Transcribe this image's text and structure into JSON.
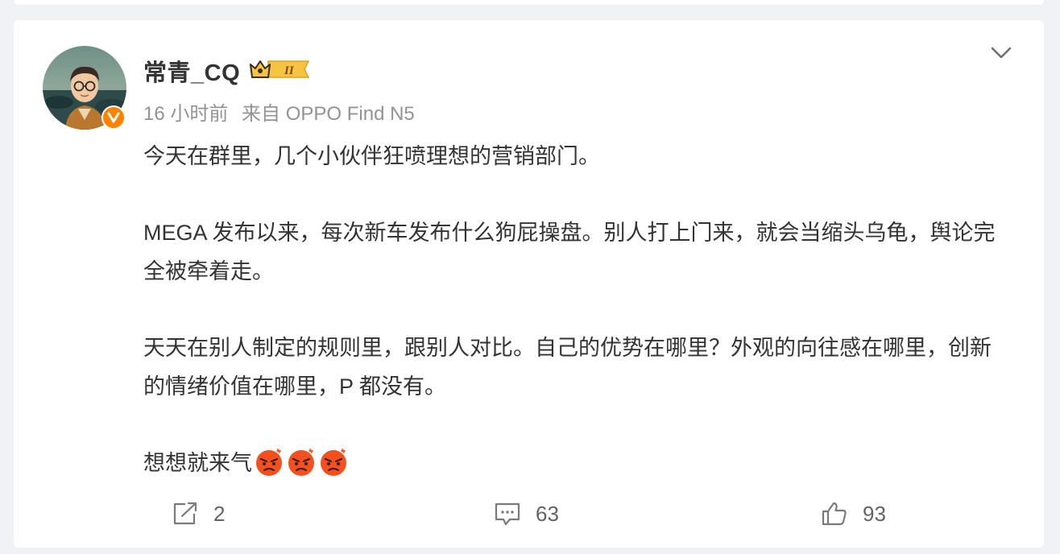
{
  "post": {
    "author": {
      "name": "常青_CQ",
      "avatar": "avatar",
      "badge_icon": "crown-level-badge-icon",
      "badge_level": "II",
      "verified_icon": "verified-v-icon"
    },
    "time": "16 小时前",
    "source": "来自 OPPO Find N5",
    "more_icon": "chevron-down-icon",
    "paragraphs": [
      "今天在群里，几个小伙伴狂喷理想的营销部门。",
      "MEGA 发布以来，每次新车发布什么狗屁操盘。别人打上门来，就会当缩头乌龟，舆论完全被牵着走。",
      "天天在别人制定的规则里，跟别人对比。自己的优势在哪里？外观的向往感在哪里，创新的情绪价值在哪里，P 都没有。",
      "想想就来气"
    ],
    "emojis": [
      "angry-emoji",
      "angry-emoji",
      "angry-emoji"
    ]
  },
  "actions": {
    "repost": {
      "icon": "repost-icon",
      "count": "2"
    },
    "comment": {
      "icon": "comment-icon",
      "count": "63"
    },
    "like": {
      "icon": "thumbs-up-icon",
      "count": "93"
    }
  },
  "colors": {
    "page_background": "#f1f2f5",
    "card_background": "#ffffff",
    "text_primary": "#333333",
    "text_meta": "#939393",
    "verified_orange": "#ff8200",
    "badge_gold": "#f6c342"
  }
}
